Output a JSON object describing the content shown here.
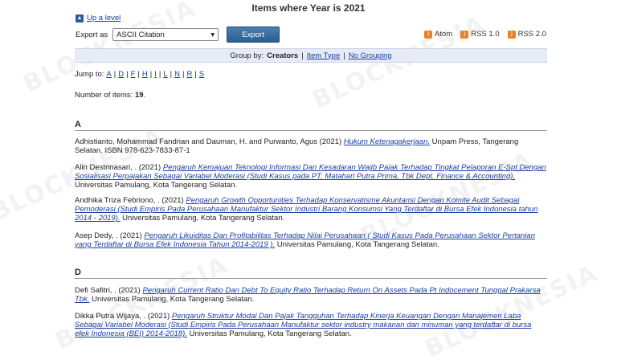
{
  "page_title": "Items where Year is 2021",
  "up_level_label": "Up a level",
  "export": {
    "label": "Export as",
    "selected": "ASCII Citation",
    "button": "Export"
  },
  "feeds": [
    {
      "icon": "rss-feed-icon",
      "label": "Atom"
    },
    {
      "icon": "rss-feed-icon",
      "label": "RSS 1.0"
    },
    {
      "icon": "rss-feed-icon",
      "label": "RSS 2.0"
    }
  ],
  "groupby": {
    "label": "Group by:",
    "current": "Creators",
    "options": [
      "Item Type",
      "No Grouping"
    ]
  },
  "jump": {
    "label": "Jump to:",
    "letters": [
      "A",
      "D",
      "F",
      "H",
      "I",
      "L",
      "N",
      "R",
      "S"
    ]
  },
  "count": {
    "label": "Number of items:",
    "value": "19"
  },
  "sections": [
    {
      "letter": "A",
      "entries": [
        {
          "authors": "Adhistianto, Mohammad Fandrian and Dauman, H. and Purwanto, Agus (2021)",
          "title": "Hukum Ketenagakerjaan.",
          "rest": "Unpam Press, Tangerang Selatan. ISBN 978-623-7833-87-1"
        },
        {
          "authors": "Alin Destrinasari, . (2021)",
          "title": "Pengaruh Kemajuan Teknologi Informasi Dan Kesadaran Wajib Pajak Terhadap Tingkat Pelaporan E-Spt Dengan Sosialisasi Perpajakan Sebagai Variabel Moderasi (Studi Kasus pada PT. Matahari Putra Prima, Tbk Dept. Finance & Accounting).",
          "rest": "Universitas Pamulang, Kota Tangerang Selatan."
        },
        {
          "authors": "Andhika Triza Febriono, . (2021)",
          "title": "Pengaruh Growth Opportunities Terhadap Konservatisme Akuntansi Dengan Komite Audit Sebagai Pemoderasi (Studi Empiris Pada Perusahaan Manufaktur Sektor Industri Barang Konsumsi Yang Terdaftar di Bursa Efek Indonesia tahun 2014 - 2019).",
          "rest": "Universitas Pamulang, Kota Tangerang Selatan."
        },
        {
          "authors": "Asep Dedy, . (2021)",
          "title": "Pengaruh Likuiditas Dan Profitabilitas Terhadap Nilai Perusahaan ( Studi Kasus Pada Perusahaan Sektor Pertanian yang Terdaftar di Bursa Efek Indonesia Tahun 2014-2019 ).",
          "rest": "Universitas Pamulang, Kota Tangerang Selatan."
        }
      ]
    },
    {
      "letter": "D",
      "entries": [
        {
          "authors": "Defi Safitri, . (2021)",
          "title": "Pengaruh Current Ratio Dan Debt To Equity Ratio Terhadap Return On Assets Pada Pt Indocement Tunggal Prakarsa Tbk.",
          "rest": "Universitas Pamulang, Kota Tangerang Selatan."
        },
        {
          "authors": "Dikka Putra Wijaya, . (2021)",
          "title": "Pengaruh Struktur Modal Dan Pajak Tangguhan Terhadap Kinerja Keuangan Dengan Manajemen Laba Sebagai Variabel Moderasi (Studi Empiris Pada Perusahaan Manufaktur sektor industry makanan dan minuman yang terdaftar di bursa efek Indonesia (BEI) 2014-2018).",
          "rest": "Universitas Pamulang, Kota Tangerang Selatan."
        }
      ]
    }
  ]
}
